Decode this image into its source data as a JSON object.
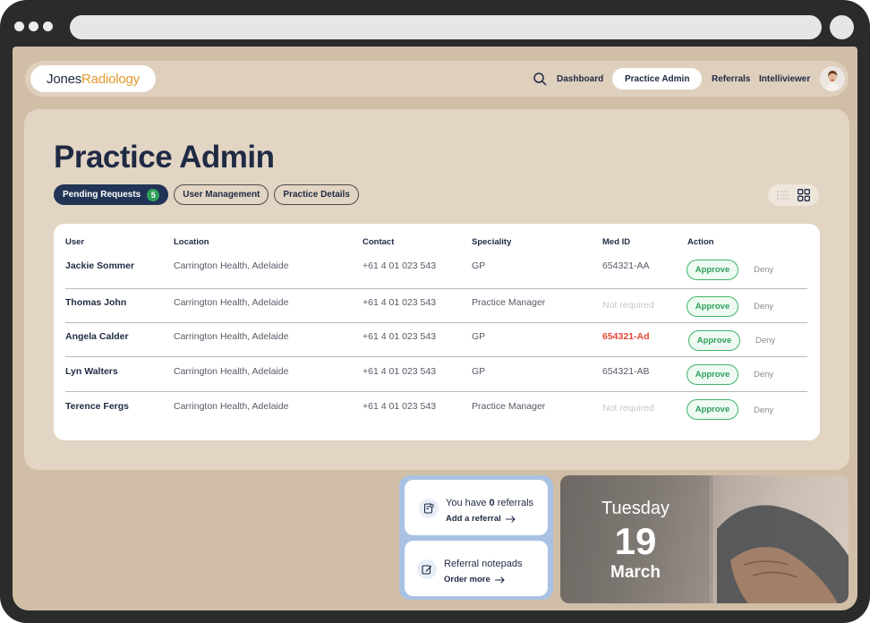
{
  "brand": {
    "part1": "Jones",
    "part2": "Radiology"
  },
  "nav": {
    "items": [
      {
        "label": "Dashboard"
      },
      {
        "label": "Practice Admin",
        "active": true
      },
      {
        "label": "Referrals"
      },
      {
        "label": "Intelliviewer"
      }
    ]
  },
  "page": {
    "title": "Practice Admin"
  },
  "tabs": [
    {
      "label": "Pending Requests",
      "badge": "5",
      "active": true
    },
    {
      "label": "User Management"
    },
    {
      "label": "Practice Details"
    }
  ],
  "table": {
    "headers": [
      "User",
      "Location",
      "Contact",
      "Speciality",
      "Med ID",
      "Action"
    ],
    "rows": [
      {
        "user": "Jackie Sommer",
        "location": "Carrington Health, Adelaide",
        "contact": "+61 4 01 023 543",
        "speciality": "GP",
        "med_id": "654321-AA",
        "med_state": "normal"
      },
      {
        "user": "Thomas John",
        "location": "Carrington Health, Adelaide",
        "contact": "+61 4 01 023 543",
        "speciality": "Practice Manager",
        "med_id": "Not required",
        "med_state": "muted"
      },
      {
        "user": "Angela Calder",
        "location": "Carrington Health, Adelaide",
        "contact": "+61 4 01 023 543",
        "speciality": "GP",
        "med_id": "654321-Ad",
        "med_state": "error"
      },
      {
        "user": "Lyn Walters",
        "location": "Carrington Health, Adelaide",
        "contact": "+61 4 01 023 543",
        "speciality": "GP",
        "med_id": "654321-AB",
        "med_state": "normal"
      },
      {
        "user": "Terence Fergs",
        "location": "Carrington Health, Adelaide",
        "contact": "+61 4 01 023 543",
        "speciality": "Practice Manager",
        "med_id": "Not required",
        "med_state": "muted"
      }
    ],
    "approve_label": "Approve",
    "deny_label": "Deny"
  },
  "widgets": {
    "referrals": {
      "title_prefix": "You have ",
      "count": "0",
      "title_suffix": " referrals",
      "link": "Add a referral"
    },
    "notepads": {
      "title": "Referral notepads",
      "link": "Order more"
    }
  },
  "date_card": {
    "day": "Tuesday",
    "date": "19",
    "month": "March"
  },
  "colors": {
    "page_bg": "#d1bea6",
    "primary": "#213456",
    "brand_accent": "#e49a2c",
    "approve": "#2fa05a",
    "error": "#e0463a",
    "badge": "#2fa05a"
  },
  "icons": [
    "search-icon",
    "list-view-icon",
    "grid-view-icon",
    "referral-doc-icon",
    "edit-icon",
    "arrow-right-icon"
  ]
}
